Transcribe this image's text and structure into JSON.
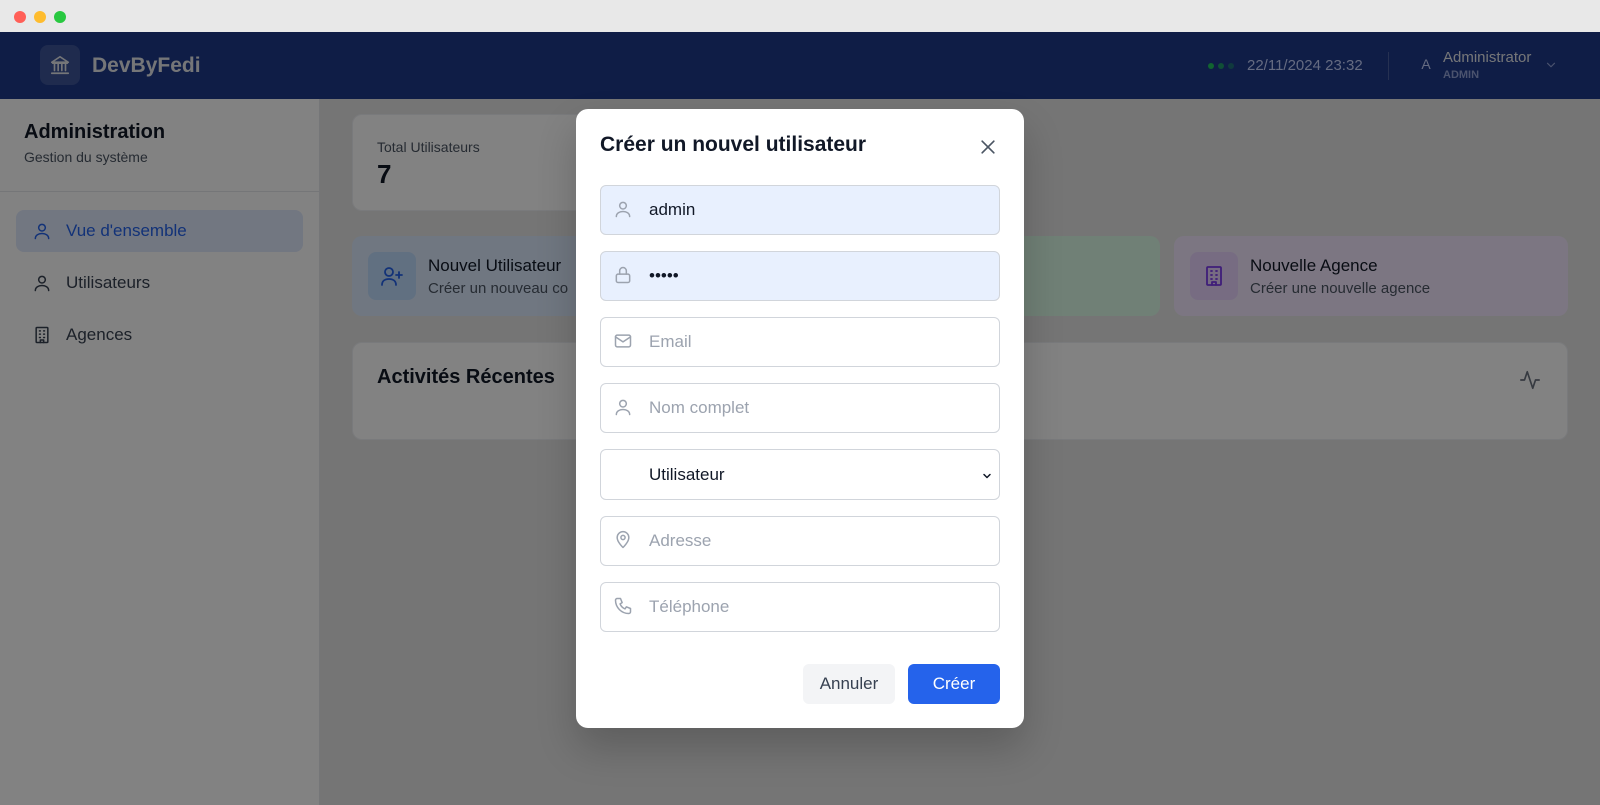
{
  "header": {
    "brand": "DevByFedi",
    "datetime": "22/11/2024 23:32",
    "avatar_letter": "A",
    "user_name": "Administrator",
    "user_role": "ADMIN"
  },
  "sidebar": {
    "title": "Administration",
    "subtitle": "Gestion du système",
    "items": [
      {
        "label": "Vue d'ensemble",
        "icon": "user-icon",
        "active": true
      },
      {
        "label": "Utilisateurs",
        "icon": "user-icon",
        "active": false
      },
      {
        "label": "Agences",
        "icon": "building-icon",
        "active": false
      }
    ]
  },
  "main": {
    "stat": {
      "label": "Total Utilisateurs",
      "value": "7"
    },
    "actions": [
      {
        "title": "Nouvel Utilisateur",
        "subtitle": "Créer un nouveau co",
        "icon": "user-plus-icon",
        "color": "#dbeafe"
      },
      {
        "title": "",
        "subtitle": "",
        "icon": "",
        "color": "#dcfce7"
      },
      {
        "title": "Nouvelle Agence",
        "subtitle": "Créer une nouvelle agence",
        "icon": "building-icon",
        "color": "#f3e8ff"
      }
    ],
    "activities_title": "Activités Récentes"
  },
  "modal": {
    "title": "Créer un nouvel utilisateur",
    "username": {
      "value": "admin",
      "placeholder": ""
    },
    "password": {
      "value": "admin",
      "placeholder": ""
    },
    "email": {
      "value": "",
      "placeholder": "Email"
    },
    "fullname": {
      "value": "",
      "placeholder": "Nom complet"
    },
    "role": {
      "selected": "Utilisateur"
    },
    "address": {
      "value": "",
      "placeholder": "Adresse"
    },
    "phone": {
      "value": "",
      "placeholder": "Téléphone"
    },
    "cancel_label": "Annuler",
    "create_label": "Créer"
  },
  "colors": {
    "header_bg": "#1e3a8a",
    "primary": "#2563eb",
    "status_green": "#22c55e"
  }
}
